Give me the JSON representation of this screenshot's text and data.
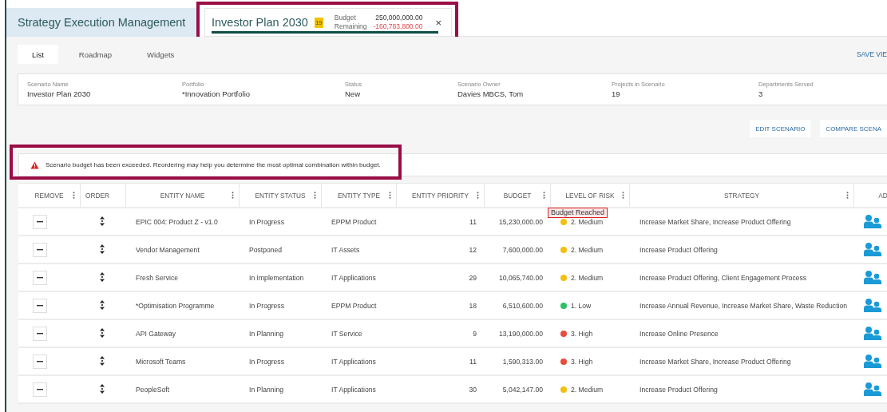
{
  "app_title": "Strategy Execution Management",
  "scenario_tab": {
    "title": "Investor Plan 2030",
    "count": "19",
    "budget_label": "Budget",
    "budget_value": "250,000,000.00",
    "remaining_label": "Remaining",
    "remaining_value": "-160,783,800.00",
    "close": "×",
    "selected": true
  },
  "view_tabs": [
    {
      "label": "List",
      "selected": true
    },
    {
      "label": "Roadmap",
      "selected": false
    },
    {
      "label": "Widgets",
      "selected": false
    }
  ],
  "save_view": "SAVE VIE",
  "scenario_info": [
    {
      "label": "Scenario Name",
      "value": "Investor Plan 2030"
    },
    {
      "label": "Portfolio",
      "value": "*Innovation Portfolio"
    },
    {
      "label": "Status",
      "value": "New"
    },
    {
      "label": "Scenario Owner",
      "value": "Davies MBCS, Tom"
    },
    {
      "label": "Projects in Scenario",
      "value": "19"
    },
    {
      "label": "Departments Served",
      "value": "3"
    }
  ],
  "actions": [
    "EDIT SCENARIO",
    "COMPARE SCENA"
  ],
  "alert": {
    "message": "Scenario budget has been exceeded. Reordering may help you determine the most optimal combination within budget."
  },
  "table": {
    "columns": [
      {
        "label": "REMOVE",
        "menu": true
      },
      {
        "label": "ORDER",
        "menu": false
      },
      {
        "label": "ENTITY NAME",
        "menu": true
      },
      {
        "label": "ENTITY STATUS",
        "menu": true
      },
      {
        "label": "ENTITY TYPE",
        "menu": true
      },
      {
        "label": "ENTITY PRIORITY",
        "menu": true
      },
      {
        "label": "BUDGET",
        "menu": true
      },
      {
        "label": "LEVEL OF RISK",
        "menu": true
      },
      {
        "label": "STRATEGY",
        "menu": true
      },
      {
        "label": "AD"
      }
    ],
    "rows": [
      {
        "name": "EPIC 004: Product Z - v1.0",
        "status": "In Progress",
        "type": "EPPM Product",
        "priority": "11",
        "budget": "15,230,000.00",
        "risk": "2. Medium",
        "color": "#f2c00f",
        "strategy": "Increase Market Share, Increase Product Offering",
        "tooltip": "Budget Reached"
      },
      {
        "name": "Vendor Management",
        "status": "Postponed",
        "type": "IT Assets",
        "priority": "12",
        "budget": "7,600,000.00",
        "risk": "2. Medium",
        "color": "#f2c00f",
        "strategy": "Increase Product Offering"
      },
      {
        "name": "Fresh Service",
        "status": "In Implementation",
        "type": "IT Applications",
        "priority": "29",
        "budget": "10,065,740.00",
        "risk": "2. Medium",
        "color": "#f2c00f",
        "strategy": "Increase Product Offering, Client Engagement Process"
      },
      {
        "name": "*Optimisation Programme",
        "status": "In Progress",
        "type": "EPPM Product",
        "priority": "18",
        "budget": "6,510,600.00",
        "risk": "1. Low",
        "color": "#2ec065",
        "strategy": "Increase Annual Revenue, Increase Market Share, Waste Reduction"
      },
      {
        "name": "API Gateway",
        "status": "In Planning",
        "type": "IT Service",
        "priority": "9",
        "budget": "13,190,000.00",
        "risk": "3. High",
        "color": "#e74c3c",
        "strategy": "Increase Online Presence"
      },
      {
        "name": "Microsoft Teams",
        "status": "In Progress",
        "type": "IT Applications",
        "priority": "11",
        "budget": "1,590,313.00",
        "risk": "3. High",
        "color": "#e74c3c",
        "strategy": "Increase Market Share, Increase Product Offering"
      },
      {
        "name": "PeopleSoft",
        "status": "In Planning",
        "type": "IT Applications",
        "priority": "30",
        "budget": "5,042,147.00",
        "risk": "2. Medium",
        "color": "#f2c00f",
        "strategy": "Increase Product Offering"
      }
    ]
  }
}
